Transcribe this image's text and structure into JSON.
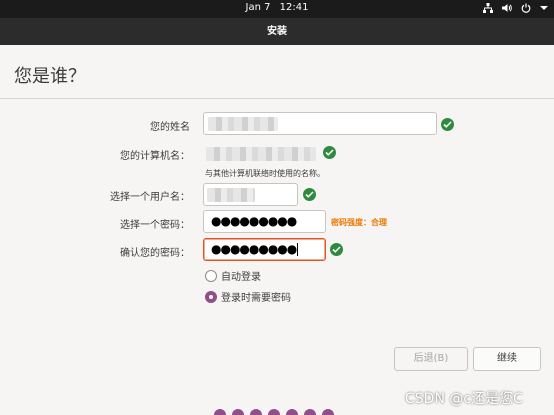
{
  "topbar": {
    "date": "Jan 7",
    "time": "12:41",
    "icons": [
      "network-icon",
      "volume-icon",
      "power-icon",
      "chevron-down-icon"
    ]
  },
  "window": {
    "title": "安装"
  },
  "page": {
    "heading": "您是谁？"
  },
  "form": {
    "name_label": "您的姓名",
    "computer_label": "您的计算机名：",
    "computer_hint": "与其他计算机联络时使用的名称。",
    "username_label": "选择一个用户名：",
    "password_label": "选择一个密码：",
    "password_value": "●●●●●●●●●",
    "password_strength": "密码强度：合理",
    "confirm_label": "确认您的密码：",
    "confirm_value": "●●●●●●●●●"
  },
  "login_options": {
    "auto_login": "自动登录",
    "require_password": "登录时需要密码",
    "selected": "require_password"
  },
  "buttons": {
    "back": "后退(B)",
    "continue": "继续"
  },
  "progress": {
    "dots": 7
  },
  "watermark": "CSDN @c还是您C",
  "colors": {
    "accent": "#924d8b",
    "focus": "#e95420",
    "ok": "#2e8b3e",
    "strength": "#f07800"
  }
}
